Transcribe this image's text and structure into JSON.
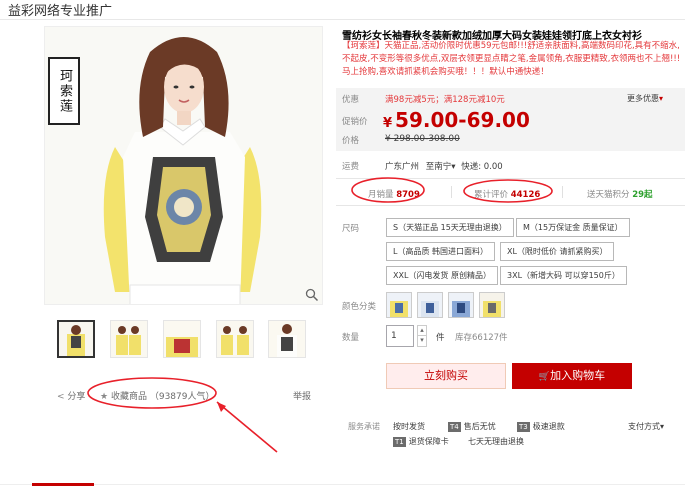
{
  "header": {
    "title": "益彩网络专业推广"
  },
  "product": {
    "title": "雪纺衫女长袖春秋冬装新款加绒加厚大码女装娃娃领打底上衣女衬衫",
    "desc": "【珂索莲】天猫正品,活动价限时优惠59元包邮!!!舒适亲肤面料,高端数码印花,具有不缩水,不起皮,不变形等很多优点,双层衣领更显点睛之笔,金属领角,衣服更精致,衣领两也不上翘!!!马上抢购,喜欢请抓紧机会购买哦！！！默认中通快递！",
    "brand_stamp": "珂索莲"
  },
  "price_panel": {
    "promo_label": "优惠",
    "promo_text": "满98元减5元；满128元减10元",
    "more_label": "更多优惠",
    "price_label": "促销价",
    "currency": "¥",
    "price": "59.00-69.00",
    "orig_label": "价格",
    "orig_price": "¥ 298.00-308.00"
  },
  "shipping": {
    "label": "运费",
    "from": "广东广州",
    "to": "至南宁",
    "info": "快递: 0.00"
  },
  "stats": {
    "monthly_label": "月销量",
    "monthly_value": "8709",
    "reviews_label": "累计评价",
    "reviews_value": "44126",
    "points_label": "送天猫积分",
    "points_value": "29起"
  },
  "sizes": {
    "label": "尺码",
    "options": [
      "S（天猫正品 15天无理由退换）",
      "M（15万保证金 质量保证）",
      "L（高品质 韩国进口面料）",
      "XL（限时低价 请抓紧购买）",
      "XXL（闪电发货 原创精品）",
      "3XL（新增大码 可以穿150斤）"
    ]
  },
  "colors": {
    "label": "颜色分类"
  },
  "quantity": {
    "label": "数量",
    "value": "1",
    "unit": "件",
    "stock": "库存66127件"
  },
  "buttons": {
    "buy": "立刻购买",
    "cart": "加入购物车"
  },
  "services": {
    "label": "服务承诺",
    "items": [
      {
        "icon": "",
        "text": "按时发货"
      },
      {
        "icon": "T4",
        "text": "售后无忧"
      },
      {
        "icon": "T3",
        "text": "极速退款"
      },
      {
        "icon": "T1",
        "text": "退货保障卡"
      },
      {
        "icon": "",
        "text": "七天无理由退换"
      }
    ],
    "payment": "支付方式"
  },
  "social": {
    "share": "分享",
    "favorite": "收藏商品",
    "popularity": "（93879人气）",
    "report": "举报"
  },
  "colors_theme": {
    "accent": "#c40000",
    "annotation": "#e8202a",
    "shirt": "#f4e56e"
  }
}
